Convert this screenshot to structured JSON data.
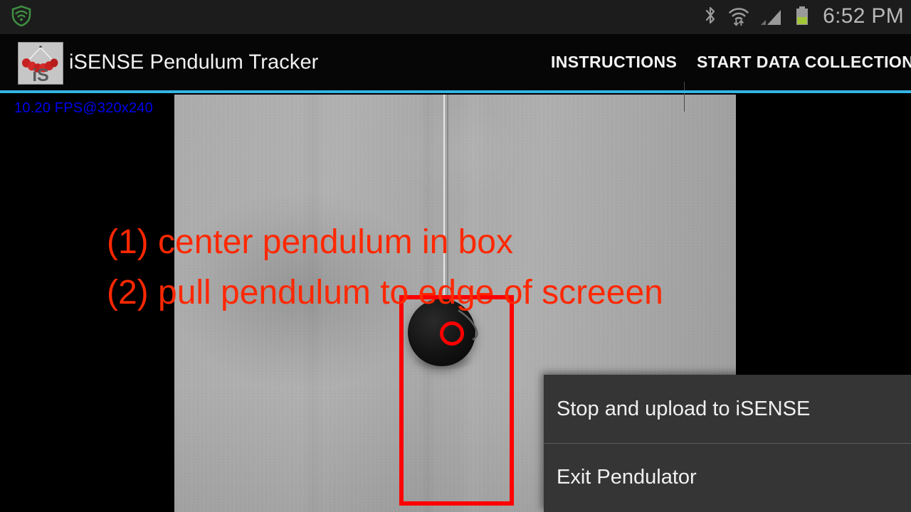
{
  "status_bar": {
    "notification_icon": "shield-security-icon",
    "icons": [
      "bluetooth-icon",
      "wifi-icon",
      "cellular-signal-icon",
      "battery-icon"
    ],
    "clock": "6:52 PM",
    "background_color": "#1c1c1c",
    "text_color": "#b8b8b8"
  },
  "action_bar": {
    "app_icon": "isense-pendulum-app-icon",
    "title": "iSENSE Pendulum Tracker",
    "actions": [
      {
        "label": "INSTRUCTIONS",
        "name": "instructions"
      },
      {
        "label": "START DATA COLLECTION",
        "name": "start-data-collection"
      }
    ],
    "accent_color": "#33b5e5",
    "background_color": "#060606"
  },
  "camera": {
    "fps_overlay": "10.20 FPS@320x240",
    "fps_color": "#0000ee",
    "preview_label": "camera-preview",
    "instructions": [
      "(1) center pendulum in box",
      "(2) pull pendulum to edge of screeen"
    ],
    "instruction_color": "#ff2800",
    "tracking_box_color": "#ff0000",
    "tracking_circle_color": "#ff0000"
  },
  "popup_menu": {
    "items": [
      {
        "label": "Stop and upload to iSENSE",
        "name": "stop-and-upload"
      },
      {
        "label": "Exit Pendulator",
        "name": "exit-pendulator"
      }
    ],
    "background_color": "#353535",
    "text_color": "#f0f0f0"
  }
}
